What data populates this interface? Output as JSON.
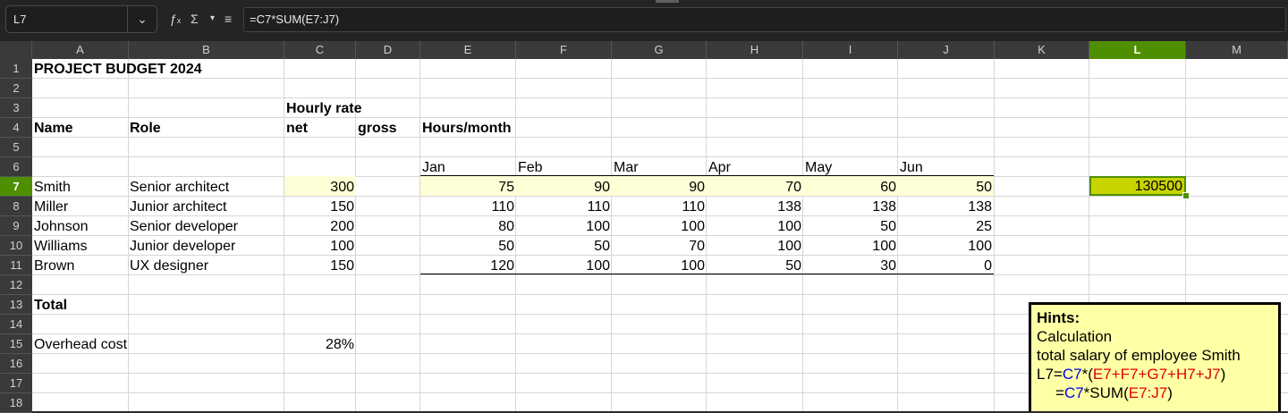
{
  "namebox": {
    "value": "L7",
    "dropdown_icon": "chevron-down-icon"
  },
  "toolbar": {
    "function_wizard_icon": "function-wizard-icon",
    "sum_icon": "Σ",
    "sum_dropdown_icon": "▾",
    "formula_icon": "≡"
  },
  "formula": "=C7*SUM(E7:J7)",
  "columns": [
    "A",
    "B",
    "C",
    "D",
    "E",
    "F",
    "G",
    "H",
    "I",
    "J",
    "K",
    "L",
    "M"
  ],
  "selected_column": "L",
  "rows": [
    "1",
    "2",
    "3",
    "4",
    "5",
    "6",
    "7",
    "8",
    "9",
    "10",
    "11",
    "12",
    "13",
    "14",
    "15",
    "16",
    "17",
    "18"
  ],
  "selected_row": "7",
  "sheet": {
    "title": "PROJECT BUDGET 2024",
    "hourly_rate": "Hourly rate",
    "headers": {
      "name": "Name",
      "role": "Role",
      "net": "net",
      "gross": "gross",
      "hours": "Hours/month"
    },
    "months": [
      "Jan",
      "Feb",
      "Mar",
      "Apr",
      "May",
      "Jun"
    ],
    "employees": [
      {
        "name": "Smith",
        "role": "Senior architect",
        "net": "300",
        "hours": [
          "75",
          "90",
          "90",
          "70",
          "60",
          "50"
        ]
      },
      {
        "name": "Miller",
        "role": "Junior architect",
        "net": "150",
        "hours": [
          "110",
          "110",
          "110",
          "138",
          "138",
          "138"
        ]
      },
      {
        "name": "Johnson",
        "role": "Senior developer",
        "net": "200",
        "hours": [
          "80",
          "100",
          "100",
          "100",
          "50",
          "25"
        ]
      },
      {
        "name": "Williams",
        "role": "Junior developer",
        "net": "100",
        "hours": [
          "50",
          "50",
          "70",
          "100",
          "100",
          "100"
        ]
      },
      {
        "name": "Brown",
        "role": "UX designer",
        "net": "150",
        "hours": [
          "120",
          "100",
          "100",
          "50",
          "30",
          "0"
        ]
      }
    ],
    "total_label": "Total",
    "overhead_label": "Overhead cost",
    "overhead_value": "28%",
    "l7_value": "130500"
  },
  "hint": {
    "title": "Hints:",
    "line1": "Calculation",
    "line2": "total salary of employee Smith",
    "f1_prefix": "L7=",
    "f1_c7": "C7",
    "f1_op": "*(",
    "f1_sum": "E7+F7+G7+H7+J7",
    "f1_close": ")",
    "f2_prefix": "=",
    "f2_c7": "C7",
    "f2_op": "*SUM(",
    "f2_range": "E7:J7",
    "f2_close": ")"
  }
}
